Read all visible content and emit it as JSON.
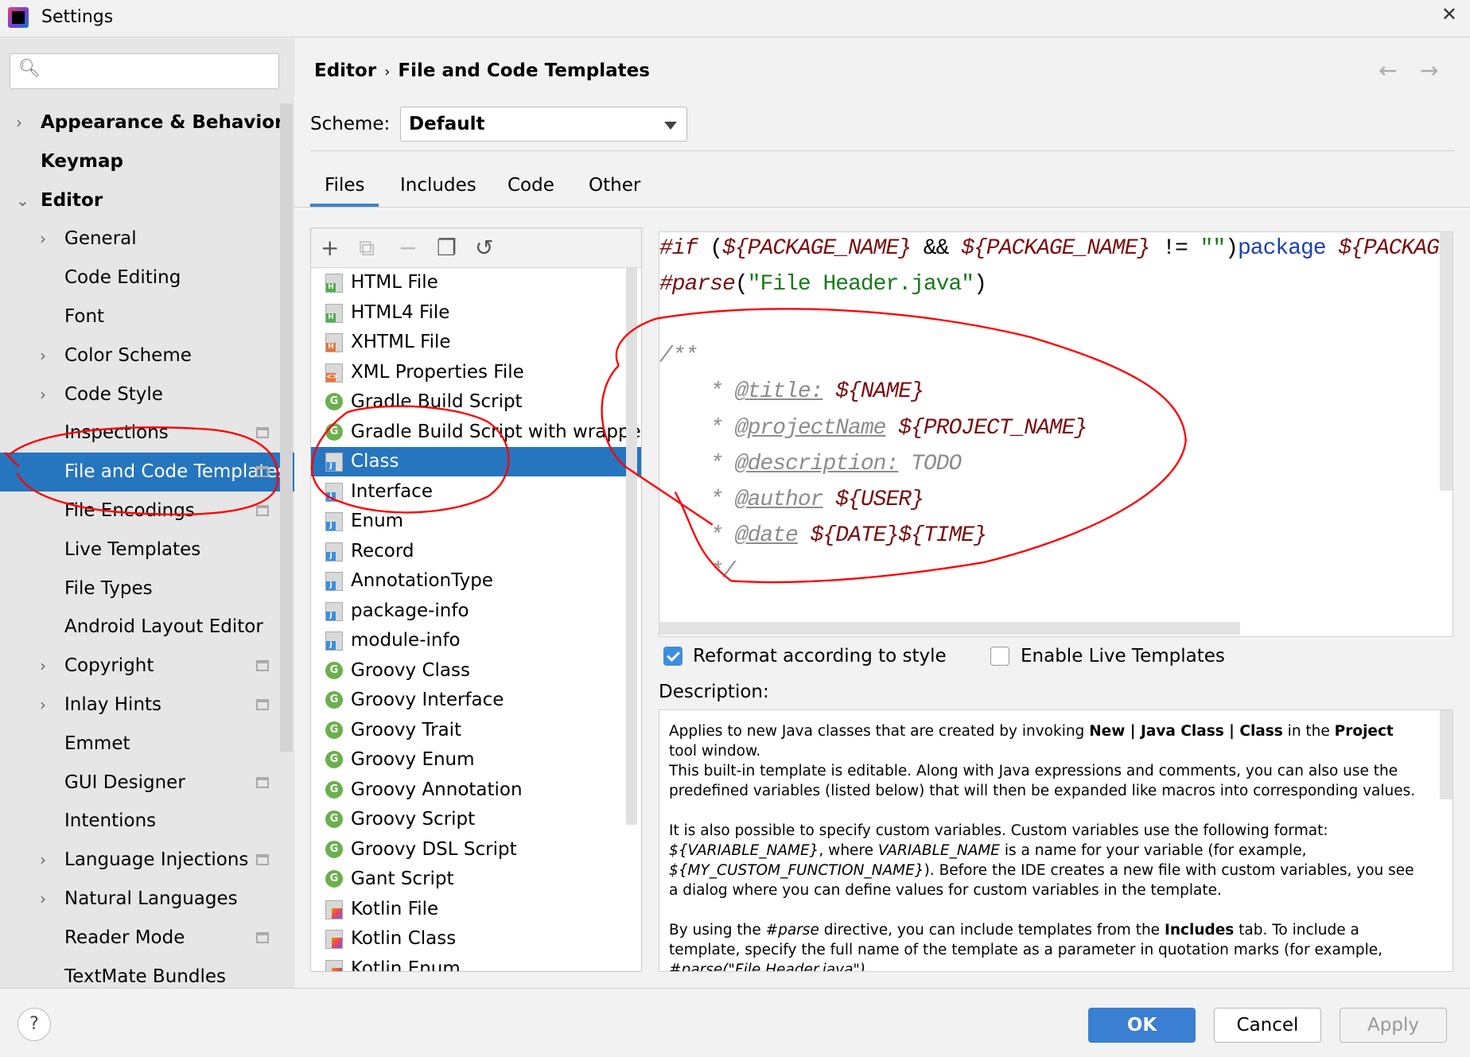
{
  "window": {
    "title": "Settings",
    "close": "✕"
  },
  "search": {
    "icon": "🔍︎",
    "placeholder": ""
  },
  "sidebar": {
    "items": [
      {
        "label": "Appearance & Behavior",
        "level": 0,
        "chevron": "›",
        "bold": true
      },
      {
        "label": "Keymap",
        "level": 0,
        "chevron": "",
        "bold": true
      },
      {
        "label": "Editor",
        "level": 0,
        "chevron": "⌄",
        "bold": true
      },
      {
        "label": "General",
        "level": 1,
        "chevron": "›"
      },
      {
        "label": "Code Editing",
        "level": 1,
        "chevron": ""
      },
      {
        "label": "Font",
        "level": 1,
        "chevron": ""
      },
      {
        "label": "Color Scheme",
        "level": 1,
        "chevron": "›"
      },
      {
        "label": "Code Style",
        "level": 1,
        "chevron": "›"
      },
      {
        "label": "Inspections",
        "level": 1,
        "chevron": "",
        "project": true
      },
      {
        "label": "File and Code Templates",
        "level": 1,
        "chevron": "",
        "selected": true,
        "project": true
      },
      {
        "label": "File Encodings",
        "level": 1,
        "chevron": "",
        "project": true
      },
      {
        "label": "Live Templates",
        "level": 1,
        "chevron": ""
      },
      {
        "label": "File Types",
        "level": 1,
        "chevron": ""
      },
      {
        "label": "Android Layout Editor",
        "level": 1,
        "chevron": ""
      },
      {
        "label": "Copyright",
        "level": 1,
        "chevron": "›",
        "project": true
      },
      {
        "label": "Inlay Hints",
        "level": 1,
        "chevron": "›",
        "project": true
      },
      {
        "label": "Emmet",
        "level": 1,
        "chevron": ""
      },
      {
        "label": "GUI Designer",
        "level": 1,
        "chevron": "",
        "project": true
      },
      {
        "label": "Intentions",
        "level": 1,
        "chevron": ""
      },
      {
        "label": "Language Injections",
        "level": 1,
        "chevron": "›",
        "project": true
      },
      {
        "label": "Natural Languages",
        "level": 1,
        "chevron": "›"
      },
      {
        "label": "Reader Mode",
        "level": 1,
        "chevron": "",
        "project": true
      },
      {
        "label": "TextMate Bundles",
        "level": 1,
        "chevron": ""
      }
    ]
  },
  "breadcrumb": {
    "parent": "Editor",
    "separator": "›",
    "current": "File and Code Templates",
    "back": "←",
    "forward": "→"
  },
  "scheme": {
    "label": "Scheme:",
    "value": "Default"
  },
  "tabs": [
    {
      "label": "Files",
      "active": true
    },
    {
      "label": "Includes"
    },
    {
      "label": "Code"
    },
    {
      "label": "Other"
    }
  ],
  "toolbar": {
    "add": "+",
    "copy": "⧉",
    "remove": "−",
    "duplicate": "❐",
    "reset": "↺"
  },
  "templates": [
    {
      "label": "HTML File",
      "icon": "doc",
      "badge": "H",
      "color": "#4caf50"
    },
    {
      "label": "HTML4 File",
      "icon": "doc",
      "badge": "H",
      "color": "#4caf50"
    },
    {
      "label": "XHTML File",
      "icon": "doc",
      "badge": "H",
      "color": "#e8743b"
    },
    {
      "label": "XML Properties File",
      "icon": "doc",
      "badge": "<>",
      "color": "#e8743b"
    },
    {
      "label": "Gradle Build Script",
      "icon": "g"
    },
    {
      "label": "Gradle Build Script with wrapper",
      "icon": "g"
    },
    {
      "label": "Class",
      "icon": "doc",
      "badge": "J",
      "color": "#3d8ee0",
      "selected": true
    },
    {
      "label": "Interface",
      "icon": "doc",
      "badge": "J",
      "color": "#3d8ee0"
    },
    {
      "label": "Enum",
      "icon": "doc",
      "badge": "J",
      "color": "#3d8ee0"
    },
    {
      "label": "Record",
      "icon": "doc",
      "badge": "J",
      "color": "#3d8ee0"
    },
    {
      "label": "AnnotationType",
      "icon": "doc",
      "badge": "J",
      "color": "#3d8ee0"
    },
    {
      "label": "package-info",
      "icon": "doc",
      "badge": "J",
      "color": "#3d8ee0"
    },
    {
      "label": "module-info",
      "icon": "doc",
      "badge": "J",
      "color": "#3d8ee0"
    },
    {
      "label": "Groovy Class",
      "icon": "g"
    },
    {
      "label": "Groovy Interface",
      "icon": "g"
    },
    {
      "label": "Groovy Trait",
      "icon": "g"
    },
    {
      "label": "Groovy Enum",
      "icon": "g"
    },
    {
      "label": "Groovy Annotation",
      "icon": "g"
    },
    {
      "label": "Groovy Script",
      "icon": "g"
    },
    {
      "label": "Groovy DSL Script",
      "icon": "g"
    },
    {
      "label": "Gant Script",
      "icon": "g"
    },
    {
      "label": "Kotlin File",
      "icon": "k"
    },
    {
      "label": "Kotlin Class",
      "icon": "k"
    },
    {
      "label": "Kotlin Enum",
      "icon": "k"
    }
  ],
  "editor": {
    "lines": [
      [
        [
          "dir",
          "#if "
        ],
        [
          "",
          "("
        ],
        [
          "var",
          "${PACKAGE_NAME}"
        ],
        [
          "",
          " && "
        ],
        [
          "var",
          "${PACKAGE_NAME}"
        ],
        [
          "",
          " != "
        ],
        [
          "str",
          "\"\""
        ],
        [
          "",
          ")"
        ],
        [
          "kw",
          "package "
        ],
        [
          "var",
          "${PACKAGE_NAME};"
        ]
      ],
      [
        [
          "dir",
          "#parse"
        ],
        [
          "",
          "("
        ],
        [
          "str",
          "\"File Header.java\""
        ],
        [
          "",
          ")"
        ]
      ],
      [],
      [
        [
          "cm",
          "/**"
        ]
      ],
      [
        [
          "cm",
          "    * "
        ],
        [
          "tag",
          "@title:"
        ],
        [
          "",
          "",
          " "
        ],
        [
          "var",
          " ${NAME}"
        ]
      ],
      [
        [
          "cm",
          "    * "
        ],
        [
          "tag",
          "@projectName"
        ],
        [
          "var",
          " ${PROJECT_NAME}"
        ]
      ],
      [
        [
          "cm",
          "    * "
        ],
        [
          "tag",
          "@description:"
        ],
        [
          "cm",
          " TODO"
        ]
      ],
      [
        [
          "cm",
          "    * "
        ],
        [
          "tag",
          "@author"
        ],
        [
          "var",
          " ${USER}"
        ]
      ],
      [
        [
          "cm",
          "    * "
        ],
        [
          "tag",
          "@date"
        ],
        [
          "var",
          " ${DATE}${TIME}"
        ]
      ],
      [
        [
          "cm",
          "    */"
        ]
      ]
    ]
  },
  "options": {
    "reformat": {
      "label": "Reformat according to style",
      "checked": true
    },
    "live_templates": {
      "label": "Enable Live Templates",
      "checked": false
    }
  },
  "description": {
    "label": "Description:",
    "html": "<p>Applies to new Java classes that are created by invoking <b>New | Java Class | Class</b> in the <b>Project</b> tool window.<br>This built-in template is editable. Along with Java expressions and comments, you can also use the predefined variables (listed below) that will then be expanded like macros into corresponding values.</p><p>It is also possible to specify custom variables. Custom variables use the following format: <i>${VARIABLE_NAME}</i>, where <i>VARIABLE_NAME</i> is a name for your variable (for example, <i>${MY_CUSTOM_FUNCTION_NAME}</i>). Before the IDE creates a new file with custom variables, you see a dialog where you can define values for custom variables in the template.</p><p>By using the <i>#parse</i> directive, you can include templates from the <b>Includes</b> tab. To include a template, specify the full name of the template as a parameter in quotation marks (for example, <i>#parse(\"File Header.java\")</i></p>"
  },
  "buttons": {
    "help": "?",
    "ok": "OK",
    "cancel": "Cancel",
    "apply": "Apply"
  },
  "colors": {
    "selection": "#2675bf",
    "accent": "#3a7fd1",
    "annotation": "#ff0000"
  }
}
